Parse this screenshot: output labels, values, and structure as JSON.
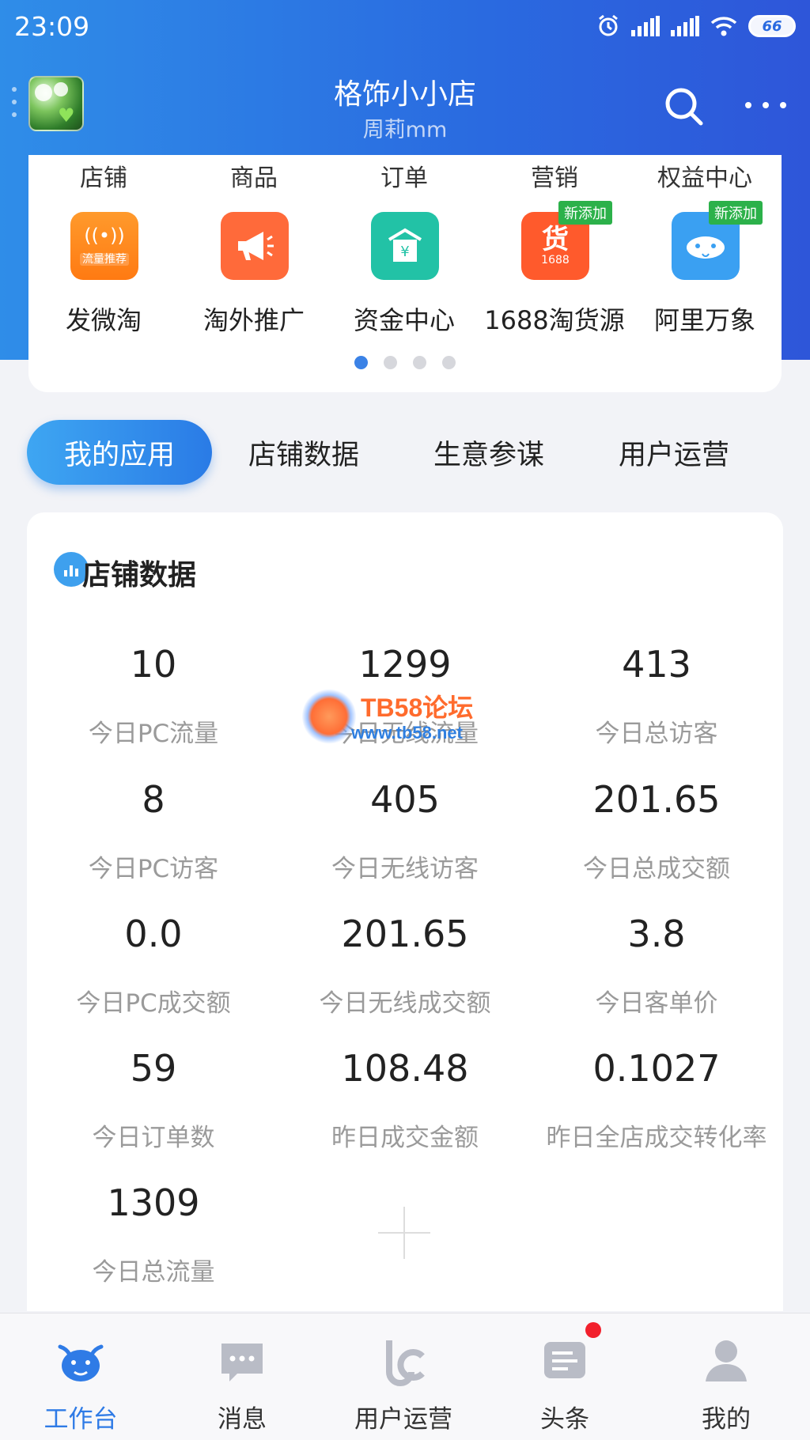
{
  "status_bar": {
    "time": "23:09",
    "battery": "66"
  },
  "header": {
    "shop_name": "格饰小小店",
    "user_name": "周莉mm"
  },
  "shortcut": {
    "categories": [
      "店铺",
      "商品",
      "订单",
      "营销",
      "权益中心"
    ],
    "apps": [
      {
        "label": "发微淘",
        "icon_text": "流量推荐",
        "color": "#ff8a1f",
        "badge": ""
      },
      {
        "label": "淘外推广",
        "icon_text": "",
        "color": "#ff6a3a",
        "badge": ""
      },
      {
        "label": "资金中心",
        "icon_text": "¥",
        "color": "#22c2a6",
        "badge": ""
      },
      {
        "label": "1688淘货源",
        "icon_text": "货",
        "icon_sub": "1688",
        "color": "#ff5a2c",
        "badge": "新添加"
      },
      {
        "label": "阿里万象",
        "icon_text": "",
        "color": "#3aa0f2",
        "badge": "新添加"
      }
    ],
    "page_count": 4,
    "active_page": 0
  },
  "section_tabs": [
    "我的应用",
    "店铺数据",
    "生意参谋",
    "用户运营"
  ],
  "data_card": {
    "title": "店铺数据",
    "metrics": [
      {
        "value": "10",
        "label": "今日PC流量"
      },
      {
        "value": "1299",
        "label": "今日无线流量"
      },
      {
        "value": "413",
        "label": "今日总访客"
      },
      {
        "value": "8",
        "label": "今日PC访客"
      },
      {
        "value": "405",
        "label": "今日无线访客"
      },
      {
        "value": "201.65",
        "label": "今日总成交额"
      },
      {
        "value": "0.0",
        "label": "今日PC成交额"
      },
      {
        "value": "201.65",
        "label": "今日无线成交额"
      },
      {
        "value": "3.8",
        "label": "今日客单价"
      },
      {
        "value": "59",
        "label": "今日订单数"
      },
      {
        "value": "108.48",
        "label": "昨日成交金额"
      },
      {
        "value": "0.1027",
        "label": "昨日全店成交转化率"
      },
      {
        "value": "1309",
        "label": "今日总流量"
      }
    ]
  },
  "watermark": {
    "line1": "TB58论坛",
    "line2": "www.tb58.net"
  },
  "bottom_nav": [
    {
      "label": "工作台",
      "icon": "cow-icon",
      "active": true
    },
    {
      "label": "消息",
      "icon": "message-icon",
      "active": false
    },
    {
      "label": "用户运营",
      "icon": "user-ops-icon",
      "active": false
    },
    {
      "label": "头条",
      "icon": "news-icon",
      "active": false
    },
    {
      "label": "我的",
      "icon": "profile-icon",
      "active": false
    }
  ],
  "colors": {
    "primary": "#2f7be6",
    "header_bg": "#2a6ae0",
    "badge_green": "#2cb14a",
    "notify_red": "#f2202c"
  }
}
